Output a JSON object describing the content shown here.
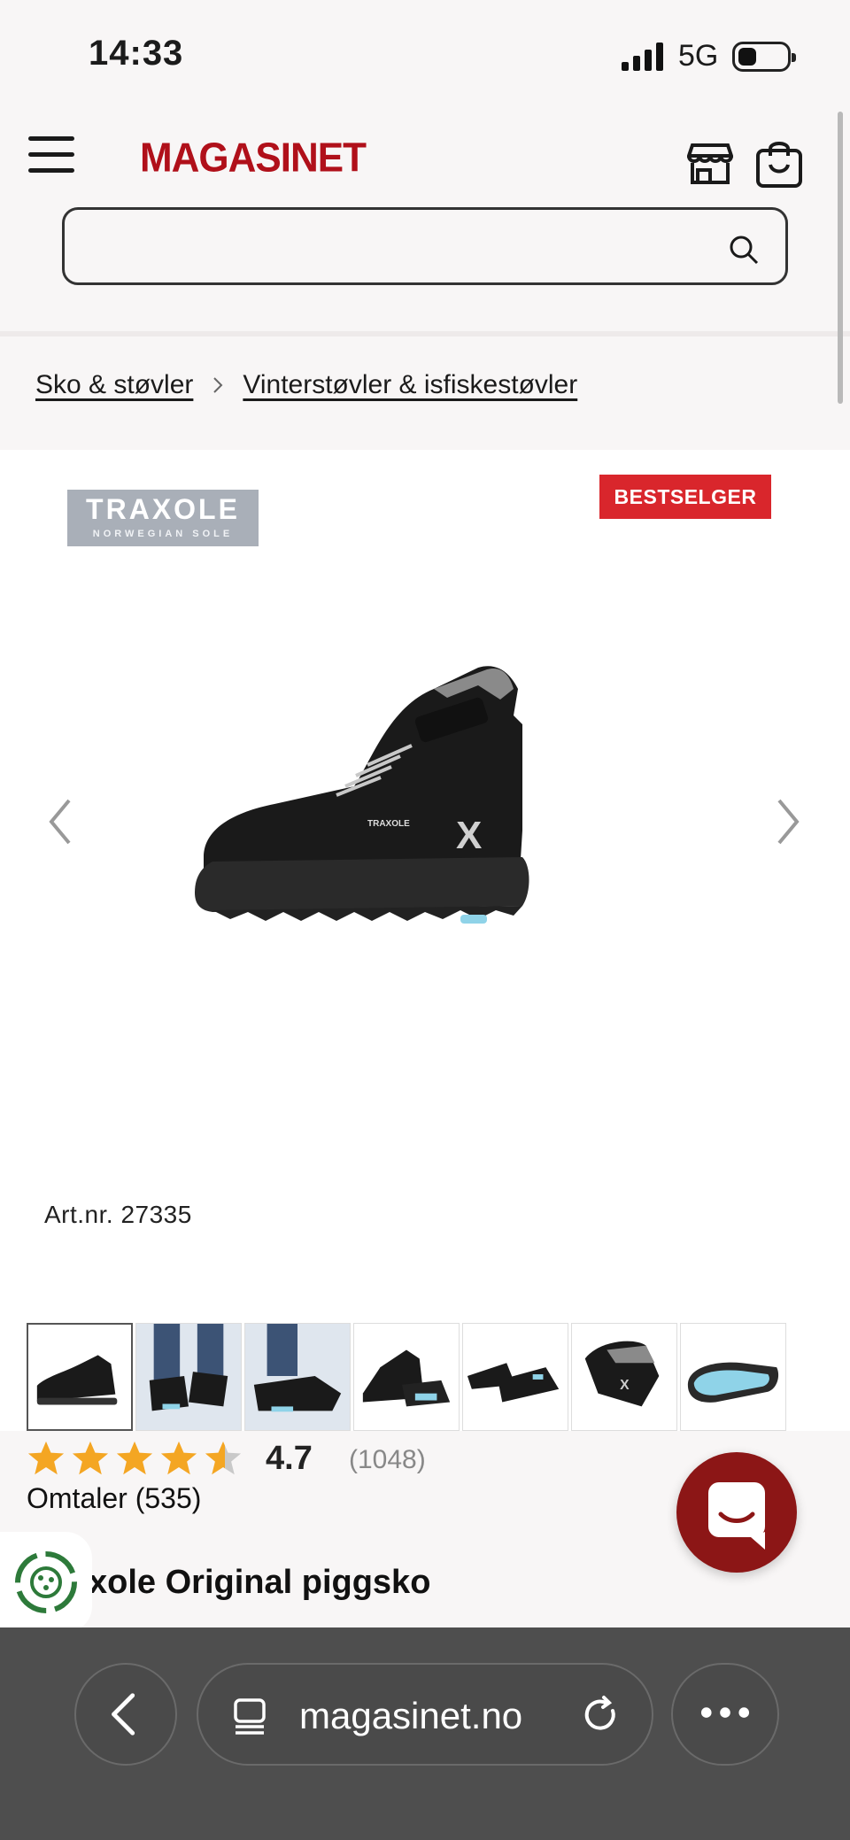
{
  "status_bar": {
    "time": "14:33",
    "network": "5G"
  },
  "header": {
    "logo": "MAGASINET",
    "search": {
      "value": "",
      "placeholder": ""
    }
  },
  "breadcrumb": {
    "items": [
      "Sko & støvler",
      "Vinterstøvler & isfiskestøvler"
    ]
  },
  "product": {
    "brand_logo_main": "TRAXOLE",
    "brand_logo_sub": "NORWEGIAN SOLE",
    "badge": "BESTSELGER",
    "art_nr": "Art.nr. 27335",
    "thumbnail_count": 7,
    "rating": {
      "value": "4.7",
      "count": "(1048)",
      "stars": 4.5
    },
    "reviews": "Omtaler (535)",
    "title_visible": "xole Original piggsko"
  },
  "browser": {
    "url": "magasinet.no"
  },
  "colors": {
    "brand_red": "#b0101a",
    "badge_red": "#d9262c",
    "star": "#f4a623",
    "chat": "#8c1616"
  }
}
